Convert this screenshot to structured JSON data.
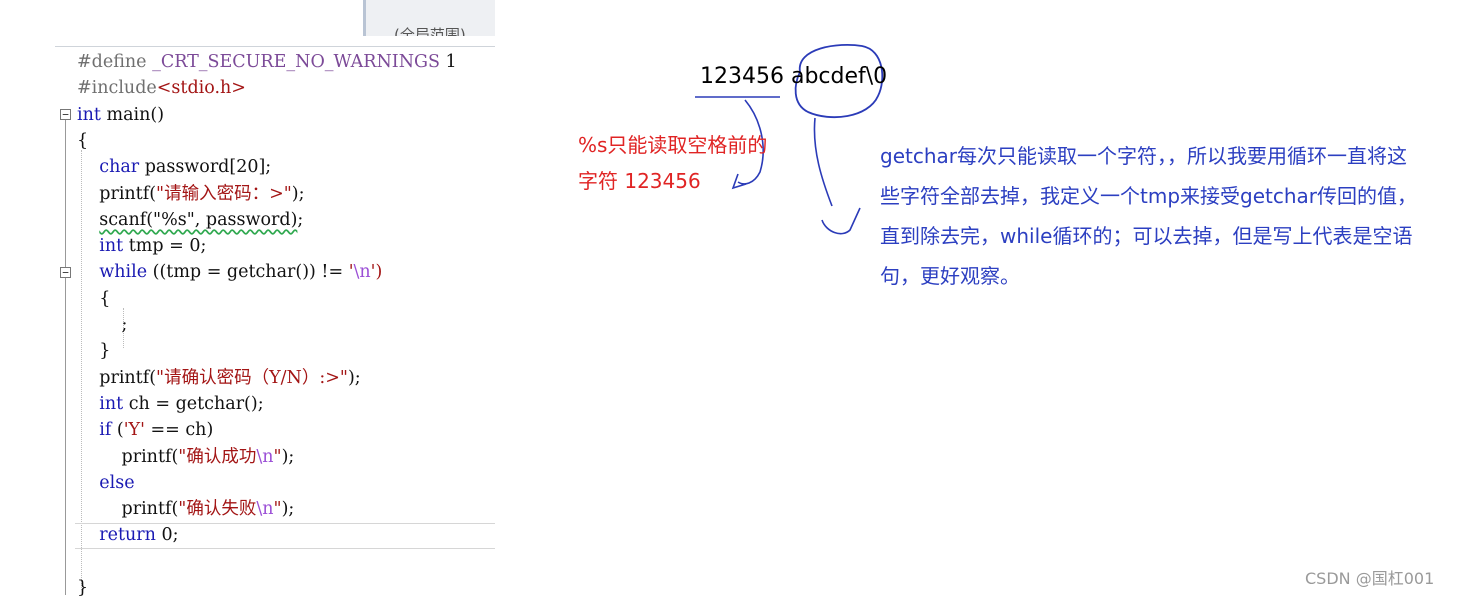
{
  "editor": {
    "top_tab_label": "(全局范围)",
    "lines": [
      {
        "tokens": [
          {
            "t": "#define ",
            "c": "pp"
          },
          {
            "t": "_CRT_SECURE_NO_WARNINGS",
            "c": "macro"
          },
          {
            "t": " 1",
            "c": ""
          }
        ]
      },
      {
        "tokens": [
          {
            "t": "#include",
            "c": "pp"
          },
          {
            "t": "<stdio.h>",
            "c": "str"
          }
        ]
      },
      {
        "tokens": [
          {
            "t": "int",
            "c": "kw"
          },
          {
            "t": " main()",
            "c": ""
          }
        ]
      },
      {
        "tokens": [
          {
            "t": "{",
            "c": ""
          }
        ]
      },
      {
        "tokens": [
          {
            "t": "    ",
            "c": ""
          },
          {
            "t": "char",
            "c": "kw"
          },
          {
            "t": " password[20];",
            "c": ""
          }
        ]
      },
      {
        "tokens": [
          {
            "t": "    printf(",
            "c": ""
          },
          {
            "t": "\"请输入密码：>\"",
            "c": "str"
          },
          {
            "t": ");",
            "c": ""
          }
        ]
      },
      {
        "tokens": [
          {
            "t": "    ",
            "c": ""
          },
          {
            "t": "scanf(\"%s\", password)",
            "c": "sq"
          },
          {
            "t": ";",
            "c": ""
          }
        ]
      },
      {
        "tokens": [
          {
            "t": "    ",
            "c": ""
          },
          {
            "t": "int",
            "c": "kw"
          },
          {
            "t": " tmp = 0;",
            "c": ""
          }
        ]
      },
      {
        "tokens": [
          {
            "t": "    ",
            "c": ""
          },
          {
            "t": "while",
            "c": "kw"
          },
          {
            "t": " ((tmp = getchar()) != ",
            "c": ""
          },
          {
            "t": "'",
            "c": "str"
          },
          {
            "t": "\\n",
            "c": "esc"
          },
          {
            "t": "')",
            "c": "str"
          }
        ]
      },
      {
        "tokens": [
          {
            "t": "    {",
            "c": ""
          }
        ]
      },
      {
        "tokens": [
          {
            "t": "        ;",
            "c": ""
          }
        ]
      },
      {
        "tokens": [
          {
            "t": "    }",
            "c": ""
          }
        ]
      },
      {
        "tokens": [
          {
            "t": "    printf(",
            "c": ""
          },
          {
            "t": "\"请确认密码（Y/N）:>\"",
            "c": "str"
          },
          {
            "t": ");",
            "c": ""
          }
        ]
      },
      {
        "tokens": [
          {
            "t": "    ",
            "c": ""
          },
          {
            "t": "int",
            "c": "kw"
          },
          {
            "t": " ch = getchar();",
            "c": ""
          }
        ]
      },
      {
        "tokens": [
          {
            "t": "    ",
            "c": ""
          },
          {
            "t": "if",
            "c": "kw"
          },
          {
            "t": " (",
            "c": ""
          },
          {
            "t": "'Y'",
            "c": "str"
          },
          {
            "t": " == ch)",
            "c": ""
          }
        ]
      },
      {
        "tokens": [
          {
            "t": "        printf(",
            "c": ""
          },
          {
            "t": "\"确认成功",
            "c": "str"
          },
          {
            "t": "\\n",
            "c": "esc"
          },
          {
            "t": "\"",
            "c": "str"
          },
          {
            "t": ");",
            "c": ""
          }
        ]
      },
      {
        "tokens": [
          {
            "t": "    ",
            "c": ""
          },
          {
            "t": "else",
            "c": "kw"
          }
        ]
      },
      {
        "tokens": [
          {
            "t": "        printf(",
            "c": ""
          },
          {
            "t": "\"确认失败",
            "c": "str"
          },
          {
            "t": "\\n",
            "c": "esc"
          },
          {
            "t": "\"",
            "c": "str"
          },
          {
            "t": ");",
            "c": ""
          }
        ]
      },
      {
        "tokens": [
          {
            "t": "    ",
            "c": ""
          },
          {
            "t": "return",
            "c": "kw"
          },
          {
            "t": " 0;",
            "c": ""
          }
        ]
      },
      {
        "tokens": [
          {
            "t": "",
            "c": ""
          }
        ]
      },
      {
        "tokens": [
          {
            "t": "}",
            "c": ""
          }
        ]
      }
    ]
  },
  "annotations": {
    "input_text": "123456 abcdef\\0",
    "red_note_line1": "%s只能读取空格前的",
    "red_note_line2": "字符     123456",
    "blue_note_lines": [
      "getchar每次只能读取一个字符，，所以我要用循环一直将这",
      "些字符全部去掉，我定义一个tmp来接受getchar传回的值，",
      "直到除去完，while循环的；可以去掉，但是写上代表是空语",
      "句，更好观察。"
    ]
  },
  "watermark": "CSDN @国杠001",
  "colors": {
    "keyword": "#1a1ab3",
    "string": "#a31515",
    "preprocessor": "#707070",
    "escape": "#9b4fd6",
    "red_note": "#e02424",
    "blue_note": "#2c3fc1",
    "watermark": "#9a9a9a"
  }
}
